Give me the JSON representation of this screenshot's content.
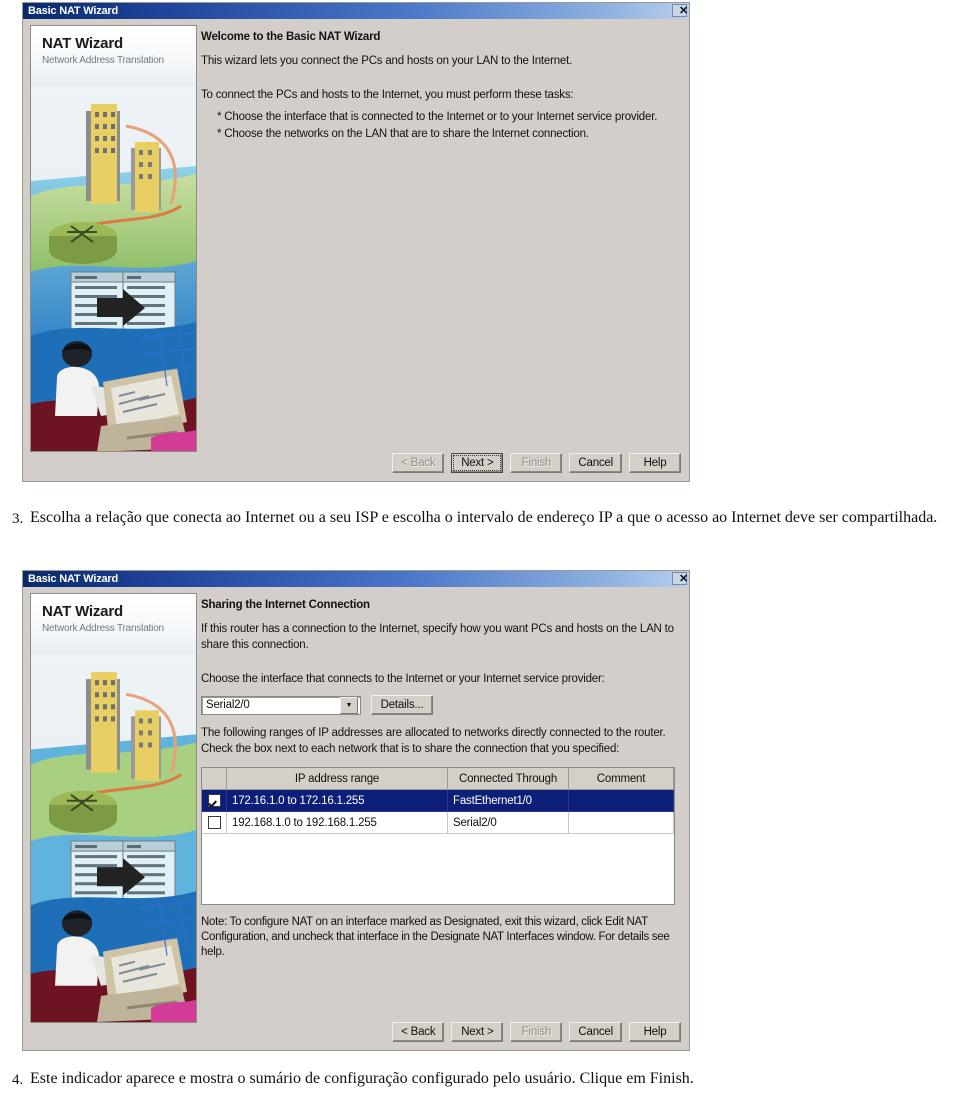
{
  "document": {
    "steps": [
      {
        "number": "3.",
        "text": "Escolha a relação que conecta ao Internet ou a seu ISP e escolha o intervalo de endereço IP a que o acesso ao Internet deve ser compartilhada."
      },
      {
        "number": "4.",
        "text": "Este indicador aparece e mostra o sumário de configuração configurado pelo usuário. Clique em Finish."
      }
    ]
  },
  "wizard_one": {
    "title": "Basic NAT Wizard",
    "close_label": "✕",
    "sidebar": {
      "title": "NAT Wizard",
      "subtitle": "Network Address Translation"
    },
    "heading": "Welcome to the Basic NAT Wizard",
    "intro": "This wizard lets you connect the PCs and hosts on your LAN to the Internet.",
    "tasks_intro": "To connect the PCs and hosts to the Internet, you must perform these tasks:",
    "tasks": [
      "* Choose the interface that is connected to the Internet or to your Internet service provider.",
      "* Choose the networks on the LAN that are to share the Internet connection."
    ],
    "buttons": {
      "back": "< Back",
      "next": "Next >",
      "finish": "Finish",
      "cancel": "Cancel",
      "help": "Help"
    }
  },
  "wizard_two": {
    "title": "Basic NAT Wizard",
    "close_label": "✕",
    "sidebar": {
      "title": "NAT Wizard",
      "subtitle": "Network Address Translation"
    },
    "heading": "Sharing the Internet Connection",
    "intro": "If this router has a connection to the Internet, specify how you want PCs and hosts on the LAN to share this connection.",
    "interface_prompt": "Choose the interface that connects to the Internet or your Internet service provider:",
    "interface_select": {
      "value": "Serial2/0",
      "arrow": "▼"
    },
    "details_button": "Details...",
    "ranges_intro": "The following ranges of IP addresses are allocated to networks directly connected to the router. Check the box next to each network that is to share the connection that you specified:",
    "table": {
      "columns": [
        "",
        "IP address range",
        "Connected Through",
        "Comment"
      ],
      "rows": [
        {
          "checked": true,
          "selected": true,
          "range": "172.16.1.0 to 172.16.1.255",
          "connected_through": "FastEthernet1/0",
          "comment": ""
        },
        {
          "checked": false,
          "selected": false,
          "range": "192.168.1.0 to 192.168.1.255",
          "connected_through": "Serial2/0",
          "comment": ""
        }
      ]
    },
    "note": "Note: To configure NAT on an interface marked as Designated, exit this wizard, click Edit NAT Configuration, and uncheck that interface in the Designate NAT Interfaces window. For details see help.",
    "buttons": {
      "back": "< Back",
      "next": "Next >",
      "finish": "Finish",
      "cancel": "Cancel",
      "help": "Help"
    }
  },
  "colors": {
    "titlebar_start": "#08296b",
    "dialog_face": "#d4cecb",
    "button_face": "#d4d0c8",
    "row_selected": "#0c1e78"
  }
}
